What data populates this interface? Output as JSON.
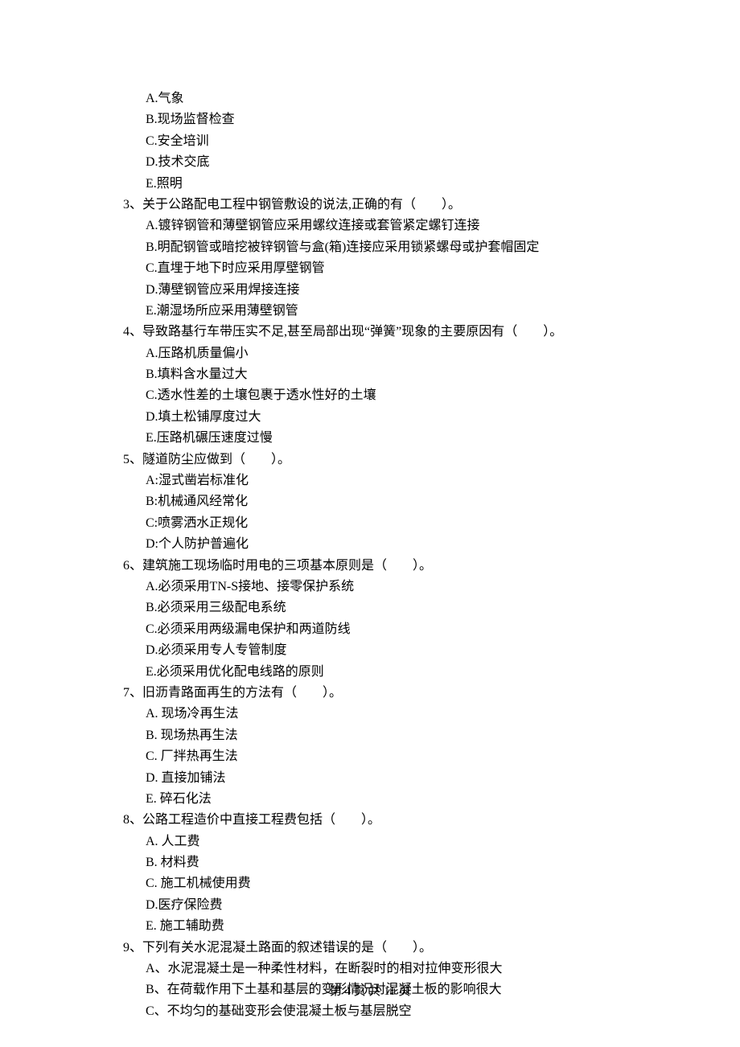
{
  "prev_options": {
    "A": "A.气象",
    "B": "B.现场监督检查",
    "C": "C.安全培训",
    "D": "D.技术交底",
    "E": "E.照明"
  },
  "q3": {
    "stem": "3、关于公路配电工程中钢管敷设的说法,正确的有（　　）。",
    "A": "A.镀锌钢管和薄壁钢管应采用螺纹连接或套管紧定螺钉连接",
    "B": "B.明配钢管或暗挖被锌钢管与盒(箱)连接应采用锁紧螺母或护套帽固定",
    "C": "C.直埋于地下时应采用厚壁钢管",
    "D": "D.薄壁钢管应采用焊接连接",
    "E": "E.潮湿场所应采用薄壁钢管"
  },
  "q4": {
    "stem": "4、导致路基行车带压实不足,甚至局部出现“弹簧”现象的主要原因有（　　）。",
    "A": "A.压路机质量偏小",
    "B": "B.填料含水量过大",
    "C": "C.透水性差的土壤包裹于透水性好的土壤",
    "D": "D.填土松铺厚度过大",
    "E": "E.压路机碾压速度过慢"
  },
  "q5": {
    "stem": "5、隧道防尘应做到（　　）。",
    "A": "A:湿式凿岩标准化",
    "B": "B:机械通风经常化",
    "C": "C:喷雾洒水正规化",
    "D": "D:个人防护普遍化"
  },
  "q6": {
    "stem": "6、建筑施工现场临时用电的三项基本原则是（　　）。",
    "A": "A.必须采用TN-S接地、接零保护系统",
    "B": "B.必须采用三级配电系统",
    "C": "C.必须采用两级漏电保护和两道防线",
    "D": "D.必须采用专人专管制度",
    "E": "E.必须采用优化配电线路的原则"
  },
  "q7": {
    "stem": "7、旧沥青路面再生的方法有（　　）。",
    "A": "A. 现场冷再生法",
    "B": "B. 现场热再生法",
    "C": "C. 厂拌热再生法",
    "D": "D. 直接加铺法",
    "E": "E. 碎石化法"
  },
  "q8": {
    "stem": "8、公路工程造价中直接工程费包括（　　）。",
    "A": "A. 人工费",
    "B": "B. 材料费",
    "C": "C. 施工机械使用费",
    "D": "D.医疗保险费",
    "E": "E. 施工辅助费"
  },
  "q9": {
    "stem": "9、下列有关水泥混凝土路面的叙述错误的是（　　）。",
    "A": "A、水泥混凝土是一种柔性材料，在断裂时的相对拉伸变形很大",
    "B": "B、在荷载作用下土基和基层的变形情况对混凝土板的影响很大",
    "C": "C、不均匀的基础变形会使混凝土板与基层脱空"
  },
  "pagenum": "第 4 页 共 11 页"
}
